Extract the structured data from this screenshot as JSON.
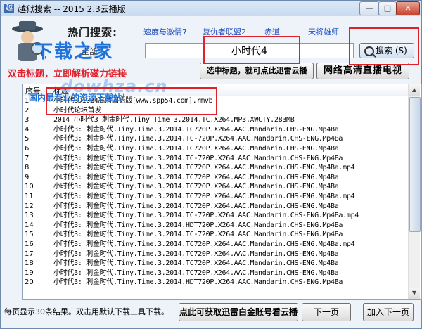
{
  "window": {
    "title": "越狱搜索 -- 2015 2.3云播版",
    "min_glyph": "—",
    "max_glyph": "□",
    "close_glyph": "✕"
  },
  "hot": {
    "label": "热门搜索:",
    "links": [
      "速度与激情7",
      "复仇者联盟2",
      "赤道",
      "天将雄师"
    ]
  },
  "logo": {
    "text": "下载之家",
    "all_label": "全部",
    "watermark": "dowhza.cn"
  },
  "search": {
    "value": "小时代4",
    "button_label": "搜索 (S)"
  },
  "hint": "双击标题，立即解析磁力链接",
  "buttons": {
    "xunlei": "选中标题，就可点此迅雷云播",
    "live": "网络高清直播电视",
    "xunlei_account": "点此可获取迅雷白金账号看云播",
    "next": "下一页",
    "add_next": "加入下一页"
  },
  "domestic_text": "国内最专业的资源下载站！",
  "table": {
    "columns": [
      "序号",
      "标题"
    ],
    "rows": [
      {
        "num": "1",
        "title": "小时代BD1024高清国语版[www.spp54.com].rmvb"
      },
      {
        "num": "2",
        "title": "小时代论坛首发"
      },
      {
        "num": "3",
        "title": "2014 小时代3 刺金时代.Tiny Time 3.2014.TC.X264.MP3.XWCTY.283MB"
      },
      {
        "num": "4",
        "title": "小时代3: 刺金时代.Tiny.Time.3.2014.TC720P.X264.AAC.Mandarin.CHS-ENG.Mp4Ba"
      },
      {
        "num": "5",
        "title": "小时代3: 刺金时代.Tiny.Time.3.2014.TC-720P.X264.AAC.Mandarin.CHS-ENG.Mp4Ba"
      },
      {
        "num": "6",
        "title": "小时代3: 刺金时代.Tiny.Time.3.2014.TC720P.X264.AAC.Mandarin.CHS-ENG.Mp4Ba"
      },
      {
        "num": "7",
        "title": "小时代3: 刺金时代.Tiny.Time.3.2014.TC-720P.X264.AAC.Mandarin.CHS-ENG.Mp4Ba"
      },
      {
        "num": "8",
        "title": "小时代3: 刺金时代.Tiny.Time.3.2014.TC720P.X264.AAC.Mandarin.CHS-ENG.Mp4Ba.mp4"
      },
      {
        "num": "9",
        "title": "小时代3: 刺金时代.Tiny.Time.3.2014.TC720P.X264.AAC.Mandarin.CHS-ENG.Mp4Ba"
      },
      {
        "num": "10",
        "title": "小时代3: 刺金时代.Tiny.Time.3.2014.TC720P.X264.AAC.Mandarin.CHS-ENG.Mp4Ba"
      },
      {
        "num": "11",
        "title": "小时代3: 刺金时代.Tiny.Time.3.2014.TC720P.X264.AAC.Mandarin.CHS-ENG.Mp4Ba.mp4"
      },
      {
        "num": "12",
        "title": "小时代3: 刺金时代.Tiny.Time.3.2014.TC720P.X264.AAC.Mandarin.CHS-ENG.Mp4Ba"
      },
      {
        "num": "13",
        "title": "小时代3: 刺金时代.Tiny.Time.3.2014.TC-720P.X264.AAC.Mandarin.CHS-ENG.Mp4Ba.mp4"
      },
      {
        "num": "14",
        "title": "小时代3: 刺金时代.Tiny.Time.3.2014.HDT720P.X264.AAC.Mandarin.CHS-ENG.Mp4Ba"
      },
      {
        "num": "15",
        "title": "小时代3: 刺金时代.Tiny.Time.3.2014.TC-720P.X264.AAC.Mandarin.CHS-ENG.Mp4Ba"
      },
      {
        "num": "16",
        "title": "小时代3: 刺金时代.Tiny.Time.3.2014.TC720P.X264.AAC.Mandarin.CHS-ENG.Mp4Ba.mp4"
      },
      {
        "num": "17",
        "title": "小时代3: 刺金时代.Tiny.Time.3.2014.TC720P.X264.AAC.Mandarin.CHS-ENG.Mp4Ba"
      },
      {
        "num": "18",
        "title": "小时代3: 刺金时代.Tiny.Time.3.2014.TC720P.X264.AAC.Mandarin.CHS-ENG.Mp4Ba"
      },
      {
        "num": "19",
        "title": "小时代3: 刺金时代.Tiny.Time.3.2014.TC720P.X264.AAC.Mandarin.CHS-ENG.Mp4Ba"
      },
      {
        "num": "20",
        "title": "小时代3: 刺金时代.Tiny.Time.3.2014.HDT720P.X264.AAC.Mandarin.CHS-ENG.Mp4Ba"
      }
    ]
  },
  "footer": {
    "info": "每页显示30条结果。双击用默认下载工具下载。"
  },
  "colors": {
    "accent_red": "#e0202a",
    "link_blue": "#1f4fbf",
    "logo_blue": "#1f73d8"
  }
}
